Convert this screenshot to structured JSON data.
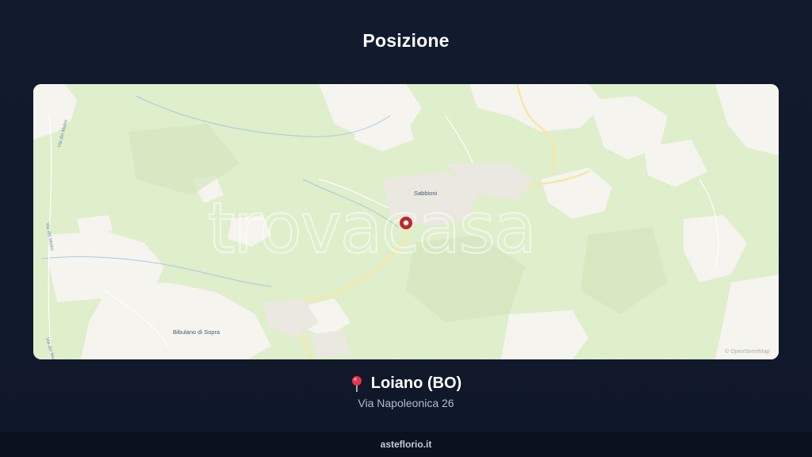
{
  "header": {
    "title": "Posizione"
  },
  "map": {
    "watermark": "trovacasa",
    "labels": {
      "sabbioni": "Sabbioni",
      "bibulano": "Bibulano di Sopra",
      "road_left_1": "Via dei Mulini",
      "road_left_2": "Via dei Mulini",
      "road_left_3": "Via dei Mulini"
    },
    "attribution": "© OpenStreetMap",
    "marker_icon": "location-marker-icon",
    "colors": {
      "forest": "#dfeecb",
      "open_land": "#f5f3ee",
      "road": "#f7e7a6",
      "water": "#a9c8e0",
      "marker": "#c0262d"
    }
  },
  "location": {
    "pin_icon": "map-pin-icon",
    "name": "Loiano (BO)",
    "address": "Via Napoleonica 26"
  },
  "footer": {
    "site": "asteflorio.it"
  }
}
